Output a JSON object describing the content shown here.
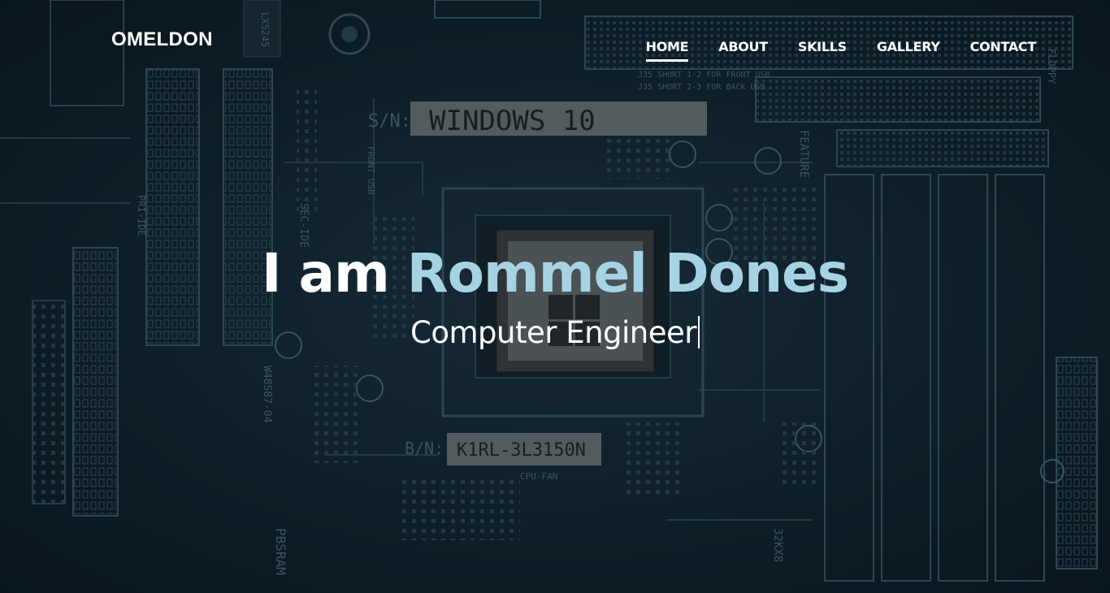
{
  "brand": {
    "label": "OMELDON"
  },
  "nav": {
    "items": [
      {
        "label": "HOME",
        "active": true
      },
      {
        "label": "ABOUT",
        "active": false
      },
      {
        "label": "SKILLS",
        "active": false
      },
      {
        "label": "GALLERY",
        "active": false
      },
      {
        "label": "CONTACT",
        "active": false
      }
    ]
  },
  "hero": {
    "intro": "I am",
    "name": "Rommel Dones",
    "role": "Computer Engineer",
    "name_color": "#a6d3e4"
  },
  "background": {
    "labels": {
      "sticker_top": "WINDOWS 10",
      "sticker_bottom": "K1RL-3L3150N",
      "serial_label": "S/N:",
      "bn_label": "B/N:",
      "cpu_fan": "CPU-FAN",
      "j35_front": "J35 SHORT 1-2 FOR FRONT USB",
      "j35_back": "J35 SHORT 2-3 FOR BACK USB",
      "pbsram": "PBSRAM",
      "feature": "FEATURE",
      "front_usb": "FRONT USB",
      "floppy": "FLOPPY",
      "pri_ide": "PRI-IDE",
      "sec_ide": "SEC-IDE",
      "w48s87": "W48S87-04",
      "chip_32kx8": "32KX8",
      "lx5245": "LX5245"
    }
  }
}
